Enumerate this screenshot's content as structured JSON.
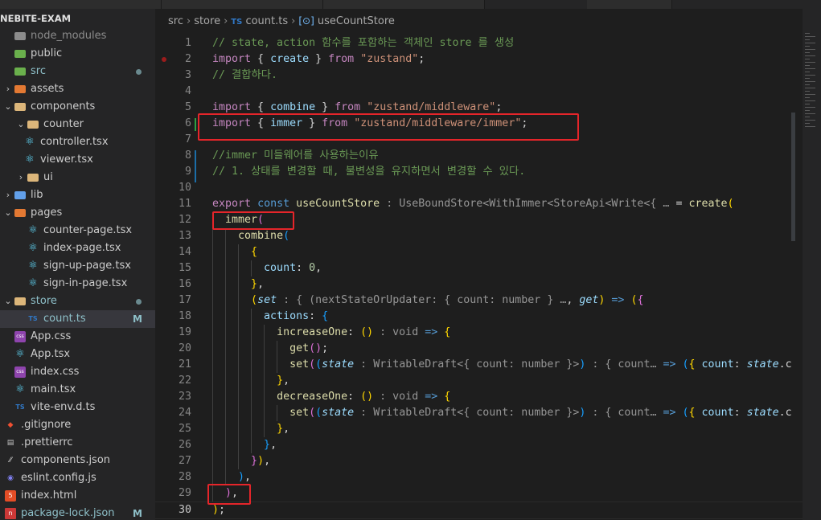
{
  "explorer": {
    "title": "NEBITE-EXAM",
    "items": [
      {
        "name": "node_modules",
        "depth": 0,
        "chevron": "",
        "icon": "folder-grey",
        "kind": "folder-grey",
        "dot": false,
        "badge": ""
      },
      {
        "name": "public",
        "depth": 0,
        "chevron": "",
        "icon": "folder-green",
        "kind": "folder-green",
        "dot": false,
        "badge": ""
      },
      {
        "name": "src",
        "depth": 0,
        "chevron": "",
        "icon": "folder-green",
        "kind": "folder-green",
        "dot": true,
        "badge": ""
      },
      {
        "name": "assets",
        "depth": 0,
        "chevron": "›",
        "icon": "folder-orange",
        "kind": "folder-orange",
        "dot": false,
        "badge": ""
      },
      {
        "name": "components",
        "depth": 0,
        "chevron": "⌄",
        "icon": "folder-yellow",
        "kind": "folder",
        "dot": false,
        "badge": ""
      },
      {
        "name": "counter",
        "depth": 1,
        "chevron": "⌄",
        "icon": "folder-yellow",
        "kind": "folder",
        "dot": false,
        "badge": ""
      },
      {
        "name": "controller.tsx",
        "depth": 2,
        "chevron": "",
        "icon": "react-icon",
        "kind": "react",
        "dot": false,
        "badge": ""
      },
      {
        "name": "viewer.tsx",
        "depth": 2,
        "chevron": "",
        "icon": "react-icon",
        "kind": "react",
        "dot": false,
        "badge": ""
      },
      {
        "name": "ui",
        "depth": 1,
        "chevron": "›",
        "icon": "folder-yellow",
        "kind": "folder",
        "dot": false,
        "badge": ""
      },
      {
        "name": "lib",
        "depth": 0,
        "chevron": "›",
        "icon": "folder-blue",
        "kind": "folder-blue",
        "dot": false,
        "badge": ""
      },
      {
        "name": "pages",
        "depth": 0,
        "chevron": "⌄",
        "icon": "folder-orange",
        "kind": "folder-orange",
        "dot": false,
        "badge": ""
      },
      {
        "name": "counter-page.tsx",
        "depth": 1,
        "chevron": "",
        "icon": "react-icon",
        "kind": "react",
        "dot": false,
        "badge": ""
      },
      {
        "name": "index-page.tsx",
        "depth": 1,
        "chevron": "",
        "icon": "react-icon",
        "kind": "react",
        "dot": false,
        "badge": ""
      },
      {
        "name": "sign-up-page.tsx",
        "depth": 1,
        "chevron": "",
        "icon": "react-icon",
        "kind": "react",
        "dot": false,
        "badge": ""
      },
      {
        "name": "sign-in-page.tsx",
        "depth": 1,
        "chevron": "",
        "icon": "react-icon",
        "kind": "react",
        "dot": false,
        "badge": ""
      },
      {
        "name": "store",
        "depth": 0,
        "chevron": "⌄",
        "icon": "folder-yellow",
        "kind": "folder",
        "dot": true,
        "badge": ""
      },
      {
        "name": "count.ts",
        "depth": 1,
        "chevron": "",
        "icon": "TS",
        "kind": "ts",
        "dot": false,
        "badge": "M",
        "active": true
      },
      {
        "name": "App.css",
        "depth": 0,
        "chevron": "",
        "icon": "css",
        "kind": "css",
        "dot": false,
        "badge": ""
      },
      {
        "name": "App.tsx",
        "depth": 0,
        "chevron": "",
        "icon": "react-icon",
        "kind": "react",
        "dot": false,
        "badge": ""
      },
      {
        "name": "index.css",
        "depth": 0,
        "chevron": "",
        "icon": "css",
        "kind": "css",
        "dot": false,
        "badge": ""
      },
      {
        "name": "main.tsx",
        "depth": 0,
        "chevron": "",
        "icon": "react-icon",
        "kind": "react",
        "dot": false,
        "badge": ""
      },
      {
        "name": "vite-env.d.ts",
        "depth": 0,
        "chevron": "",
        "icon": "TS",
        "kind": "ts",
        "dot": false,
        "badge": ""
      },
      {
        "name": ".gitignore",
        "depth": -1,
        "chevron": "",
        "icon": "git-icon",
        "kind": "git",
        "dot": false,
        "badge": ""
      },
      {
        "name": ".prettierrc",
        "depth": -1,
        "chevron": "",
        "icon": "prettier-icon",
        "kind": "prettier",
        "dot": false,
        "badge": ""
      },
      {
        "name": "components.json",
        "depth": -1,
        "chevron": "",
        "icon": "slash-icon",
        "kind": "slash",
        "dot": false,
        "badge": ""
      },
      {
        "name": "eslint.config.js",
        "depth": -1,
        "chevron": "",
        "icon": "eslint-icon",
        "kind": "eslint",
        "dot": false,
        "badge": ""
      },
      {
        "name": "index.html",
        "depth": -1,
        "chevron": "",
        "icon": "html5-icon",
        "kind": "html5",
        "dot": false,
        "badge": ""
      },
      {
        "name": "package-lock.json",
        "depth": -1,
        "chevron": "",
        "icon": "npm-icon",
        "kind": "npm",
        "dot": false,
        "badge": "M"
      }
    ]
  },
  "breadcrumb": {
    "part1": "src",
    "part2": "store",
    "file_icon": "TS",
    "file": "count.ts",
    "symbol_icon": "[⊙]",
    "symbol": "useCountStore"
  },
  "editor": {
    "current_line": 30,
    "lines": [
      {
        "n": "1",
        "tokens": [
          [
            "c-cm",
            "// state, action 함수를 포함하는 객체인 store 를 생성"
          ]
        ]
      },
      {
        "n": "2",
        "tokens": [
          [
            "c-kw",
            "import"
          ],
          [
            "c-pl",
            " { "
          ],
          [
            "c-var",
            "create"
          ],
          [
            "c-pl",
            " } "
          ],
          [
            "c-kw",
            "from"
          ],
          [
            "c-pl",
            " "
          ],
          [
            "c-st",
            "\"zustand\""
          ],
          [
            "c-pl",
            ";"
          ]
        ]
      },
      {
        "n": "3",
        "tokens": [
          [
            "c-cm",
            "// 결합하다."
          ]
        ]
      },
      {
        "n": "4",
        "tokens": []
      },
      {
        "n": "5",
        "tokens": [
          [
            "c-kw",
            "import"
          ],
          [
            "c-pl",
            " { "
          ],
          [
            "c-var",
            "combine"
          ],
          [
            "c-pl",
            " } "
          ],
          [
            "c-kw",
            "from"
          ],
          [
            "c-pl",
            " "
          ],
          [
            "c-st",
            "\"zustand/middleware\""
          ],
          [
            "c-pl",
            ";"
          ]
        ]
      },
      {
        "n": "6",
        "tokens": [
          [
            "c-kw",
            "import"
          ],
          [
            "c-pl",
            " { "
          ],
          [
            "c-var",
            "immer"
          ],
          [
            "c-pl",
            " } "
          ],
          [
            "c-kw",
            "from"
          ],
          [
            "c-pl",
            " "
          ],
          [
            "c-st",
            "\"zustand/middleware/immer\""
          ],
          [
            "c-pl",
            ";"
          ]
        ]
      },
      {
        "n": "7",
        "tokens": []
      },
      {
        "n": "8",
        "tokens": [
          [
            "c-cm",
            "//immer 미들웨어를 사용하는이유"
          ]
        ]
      },
      {
        "n": "9",
        "tokens": [
          [
            "c-cm",
            "// 1. 상태를 변경할 때, 불변성을 유지하면서 변경할 수 있다."
          ]
        ]
      },
      {
        "n": "10",
        "tokens": []
      },
      {
        "n": "11",
        "tokens": [
          [
            "c-kw",
            "export"
          ],
          [
            "c-pl",
            " "
          ],
          [
            "c-kb",
            "const"
          ],
          [
            "c-pl",
            " "
          ],
          [
            "c-fn",
            "useCountStore"
          ],
          [
            "c-hint",
            " : UseBoundStore<WithImmer<StoreApi<Write<{ … "
          ],
          [
            "c-pl",
            "= "
          ],
          [
            "c-fn",
            "create"
          ],
          [
            "c-br1",
            "("
          ]
        ]
      },
      {
        "n": "12",
        "tokens": [
          [
            "c-pl",
            "  "
          ],
          [
            "c-fn",
            "immer"
          ],
          [
            "c-br2",
            "("
          ]
        ]
      },
      {
        "n": "13",
        "tokens": [
          [
            "c-pl",
            "    "
          ],
          [
            "c-fn",
            "combine"
          ],
          [
            "c-br3",
            "("
          ]
        ]
      },
      {
        "n": "14",
        "tokens": [
          [
            "c-pl",
            "      "
          ],
          [
            "c-br1",
            "{"
          ]
        ]
      },
      {
        "n": "15",
        "tokens": [
          [
            "c-pl",
            "        "
          ],
          [
            "c-var",
            "count"
          ],
          [
            "c-pl",
            ": "
          ],
          [
            "c-num",
            "0"
          ],
          [
            "c-pl",
            ","
          ]
        ]
      },
      {
        "n": "16",
        "tokens": [
          [
            "c-pl",
            "      "
          ],
          [
            "c-br1",
            "}"
          ],
          [
            "c-pl",
            ","
          ]
        ]
      },
      {
        "n": "17",
        "tokens": [
          [
            "c-pl",
            "      "
          ],
          [
            "c-br1",
            "("
          ],
          [
            "c-it",
            "set"
          ],
          [
            "c-hint",
            " : { (nextStateOrUpdater: { count: number } …"
          ],
          [
            "c-pl",
            ", "
          ],
          [
            "c-it",
            "get"
          ],
          [
            "c-br1",
            ")"
          ],
          [
            "c-pl",
            " "
          ],
          [
            "c-kb",
            "=>"
          ],
          [
            "c-pl",
            " "
          ],
          [
            "c-br1",
            "("
          ],
          [
            "c-br2",
            "{"
          ]
        ]
      },
      {
        "n": "18",
        "tokens": [
          [
            "c-pl",
            "        "
          ],
          [
            "c-var",
            "actions"
          ],
          [
            "c-pl",
            ": "
          ],
          [
            "c-br3",
            "{"
          ]
        ]
      },
      {
        "n": "19",
        "tokens": [
          [
            "c-pl",
            "          "
          ],
          [
            "c-fn",
            "increaseOne"
          ],
          [
            "c-pl",
            ": "
          ],
          [
            "c-br1",
            "()"
          ],
          [
            "c-hint",
            " : void"
          ],
          [
            "c-pl",
            " "
          ],
          [
            "c-kb",
            "=>"
          ],
          [
            "c-pl",
            " "
          ],
          [
            "c-br1",
            "{"
          ]
        ]
      },
      {
        "n": "20",
        "tokens": [
          [
            "c-pl",
            "            "
          ],
          [
            "c-fn",
            "get"
          ],
          [
            "c-br2",
            "()"
          ],
          [
            "c-pl",
            ";"
          ]
        ]
      },
      {
        "n": "21",
        "tokens": [
          [
            "c-pl",
            "            "
          ],
          [
            "c-fn",
            "set"
          ],
          [
            "c-br2",
            "("
          ],
          [
            "c-br3",
            "("
          ],
          [
            "c-it",
            "state"
          ],
          [
            "c-hint",
            " : WritableDraft<{ count: number }>"
          ],
          [
            "c-br3",
            ")"
          ],
          [
            "c-hint",
            " : { count… "
          ],
          [
            "c-kb",
            "=>"
          ],
          [
            "c-pl",
            " "
          ],
          [
            "c-br3",
            "("
          ],
          [
            "c-br1",
            "{"
          ],
          [
            "c-pl",
            " "
          ],
          [
            "c-var",
            "count"
          ],
          [
            "c-pl",
            ": "
          ],
          [
            "c-it",
            "state"
          ],
          [
            "c-pl",
            ".c"
          ]
        ]
      },
      {
        "n": "22",
        "tokens": [
          [
            "c-pl",
            "          "
          ],
          [
            "c-br1",
            "}"
          ],
          [
            "c-pl",
            ","
          ]
        ]
      },
      {
        "n": "23",
        "tokens": [
          [
            "c-pl",
            "          "
          ],
          [
            "c-fn",
            "decreaseOne"
          ],
          [
            "c-pl",
            ": "
          ],
          [
            "c-br1",
            "()"
          ],
          [
            "c-hint",
            " : void"
          ],
          [
            "c-pl",
            " "
          ],
          [
            "c-kb",
            "=>"
          ],
          [
            "c-pl",
            " "
          ],
          [
            "c-br1",
            "{"
          ]
        ]
      },
      {
        "n": "24",
        "tokens": [
          [
            "c-pl",
            "            "
          ],
          [
            "c-fn",
            "set"
          ],
          [
            "c-br2",
            "("
          ],
          [
            "c-br3",
            "("
          ],
          [
            "c-it",
            "state"
          ],
          [
            "c-hint",
            " : WritableDraft<{ count: number }>"
          ],
          [
            "c-br3",
            ")"
          ],
          [
            "c-hint",
            " : { count… "
          ],
          [
            "c-kb",
            "=>"
          ],
          [
            "c-pl",
            " "
          ],
          [
            "c-br3",
            "("
          ],
          [
            "c-br1",
            "{"
          ],
          [
            "c-pl",
            " "
          ],
          [
            "c-var",
            "count"
          ],
          [
            "c-pl",
            ": "
          ],
          [
            "c-it",
            "state"
          ],
          [
            "c-pl",
            ".c"
          ]
        ]
      },
      {
        "n": "25",
        "tokens": [
          [
            "c-pl",
            "          "
          ],
          [
            "c-br1",
            "}"
          ],
          [
            "c-pl",
            ","
          ]
        ]
      },
      {
        "n": "26",
        "tokens": [
          [
            "c-pl",
            "        "
          ],
          [
            "c-br3",
            "}"
          ],
          [
            "c-pl",
            ","
          ]
        ]
      },
      {
        "n": "27",
        "tokens": [
          [
            "c-pl",
            "      "
          ],
          [
            "c-br2",
            "}"
          ],
          [
            "c-br1",
            ")"
          ],
          [
            "c-pl",
            ","
          ]
        ]
      },
      {
        "n": "28",
        "tokens": [
          [
            "c-pl",
            "    "
          ],
          [
            "c-br3",
            ")"
          ],
          [
            "c-pl",
            ","
          ]
        ]
      },
      {
        "n": "29",
        "tokens": [
          [
            "c-pl",
            "  "
          ],
          [
            "c-br2",
            ")"
          ],
          [
            "c-pl",
            ","
          ]
        ]
      },
      {
        "n": "30",
        "tokens": [
          [
            "c-br1",
            ")"
          ],
          [
            "c-pl",
            ";"
          ]
        ]
      }
    ]
  },
  "colors": {
    "accent_red": "#e5252a",
    "git_modified": "#8ec0c9"
  }
}
